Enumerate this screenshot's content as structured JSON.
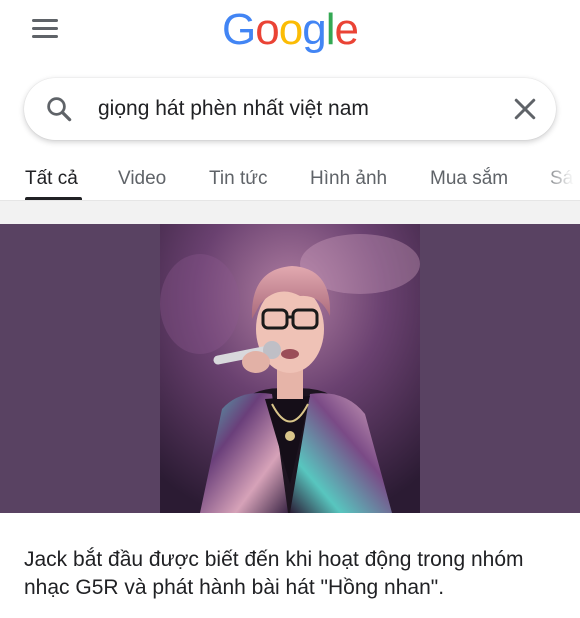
{
  "header": {
    "logo_letters": [
      "G",
      "o",
      "o",
      "g",
      "l",
      "e"
    ],
    "logo_colors": [
      "#4285F4",
      "#EA4335",
      "#FBBC05",
      "#4285F4",
      "#34A853",
      "#EA4335"
    ]
  },
  "search": {
    "query": "giọng hát phèn nhất việt nam"
  },
  "tabs": [
    {
      "label": "Tất cả",
      "active": true
    },
    {
      "label": "Video",
      "active": false
    },
    {
      "label": "Tin tức",
      "active": false
    },
    {
      "label": "Hình ảnh",
      "active": false
    },
    {
      "label": "Mua sắm",
      "active": false
    },
    {
      "label": "Sá",
      "active": false
    }
  ],
  "result": {
    "snippet": "Jack bắt đầu được biết đến khi hoạt động trong nhóm nhạc G5R và phát hành bài hát \"Hồng nhan\"."
  },
  "colors": {
    "image_panel_bg": "#594262",
    "text": "#202124",
    "tab_inactive": "#5f6368"
  }
}
